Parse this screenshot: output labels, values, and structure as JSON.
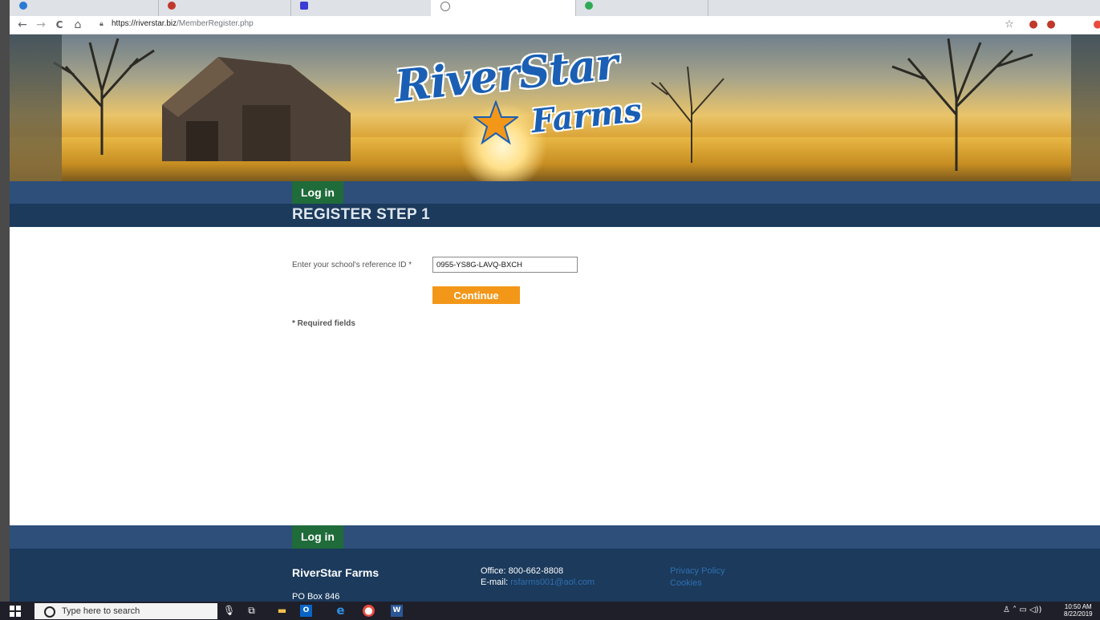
{
  "browser": {
    "url_domain": "https://riverstar.biz",
    "url_path": "/MemberRegister.php",
    "nav": {
      "back": "←",
      "forward": "→",
      "reload": "C",
      "home": "⌂"
    },
    "star_icon": "star-icon"
  },
  "site": {
    "logo_line1": "RiverStar",
    "logo_line2": "Farms",
    "nav_login": "Log in",
    "page_title": "REGISTER STEP 1"
  },
  "form": {
    "ref_label": "Enter your school's reference ID *",
    "ref_value": "0955-YS8G-LAVQ-BXCH",
    "continue_label": "Continue",
    "required_note": "* Required fields"
  },
  "footer": {
    "login": "Log in",
    "company": "RiverStar Farms",
    "po_box": "PO Box 846",
    "office": "Office: 800-662-8808",
    "email_label": "E-mail: ",
    "email": "rsfarms001@aol.com",
    "privacy": "Privacy Policy",
    "cookies": "Cookies"
  },
  "taskbar": {
    "search_placeholder": "Type here to search",
    "time": "10:50 AM",
    "date": "8/22/2019"
  },
  "colors": {
    "navbar": "#2d4f79",
    "titlebar": "#1b3a5c",
    "login_green": "#1f6b3a",
    "continue_orange": "#f39719"
  }
}
